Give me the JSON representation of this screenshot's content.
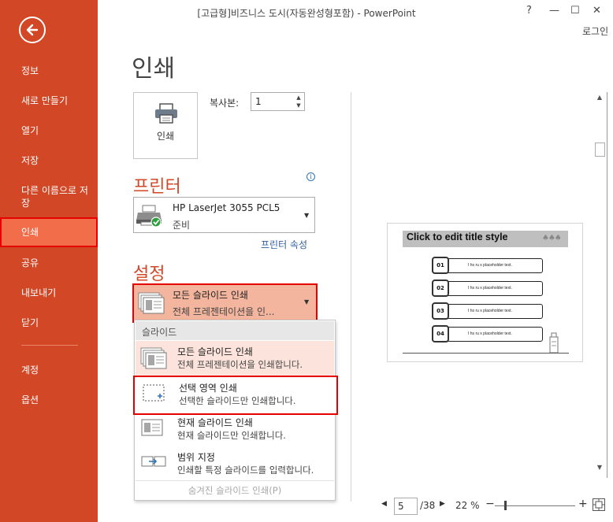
{
  "window": {
    "title": "[고급형]비즈니스 도시(자동완성형포함) - PowerPoint",
    "help": "?",
    "minimize": "—",
    "restore": "☐",
    "close": "✕",
    "login": "로그인"
  },
  "sidebar": {
    "items": [
      {
        "label": "정보"
      },
      {
        "label": "새로 만들기"
      },
      {
        "label": "열기"
      },
      {
        "label": "저장"
      },
      {
        "label": "다른 이름으로 저장"
      },
      {
        "label": "인쇄"
      },
      {
        "label": "공유"
      },
      {
        "label": "내보내기"
      },
      {
        "label": "닫기"
      },
      {
        "label": "계정"
      },
      {
        "label": "옵션"
      }
    ]
  },
  "main": {
    "title": "인쇄",
    "print_button": "인쇄",
    "copies_label": "복사본:",
    "copies_value": "1",
    "printer_heading": "프린터",
    "printer_name": "HP LaserJet 3055 PCL5",
    "printer_status": "준비",
    "printer_properties": "프린터 속성",
    "settings_heading": "설정",
    "slides_selected_title": "모든 슬라이드 인쇄",
    "slides_selected_sub": "전체 프레젠테이션을 인..."
  },
  "menu": {
    "header": "슬라이드",
    "items": [
      {
        "title": "모든 슬라이드 인쇄",
        "sub": "전체 프레젠테이션을 인쇄합니다."
      },
      {
        "title": "선택 영역 인쇄",
        "sub": "선택한 슬라이드만 인쇄합니다."
      },
      {
        "title": "현재 슬라이드 인쇄",
        "sub": "현재 슬라이드만 인쇄합니다."
      },
      {
        "title": "범위 지정",
        "sub": "인쇄할 특정 슬라이드를 입력합니다."
      }
    ],
    "hidden_option": "숨겨진 슬라이드 인쇄(P)"
  },
  "preview": {
    "slide_title": "Click to edit title style",
    "rows": [
      {
        "num": "01",
        "text": "I hs ru x placeholder text."
      },
      {
        "num": "02",
        "text": "I hs ru x placeholder text."
      },
      {
        "num": "03",
        "text": "I hs ru x placeholder text."
      },
      {
        "num": "04",
        "text": "I hs ru x placeholder text."
      }
    ]
  },
  "bottom": {
    "page": "5",
    "total": "/38",
    "zoom": "22 %",
    "zoom_minus": "−",
    "zoom_plus": "+"
  },
  "colors": {
    "sidebar": "#D24726",
    "sidebar_active": "#F26D4A",
    "heading": "#D24726",
    "highlight_box": "#E60000"
  }
}
